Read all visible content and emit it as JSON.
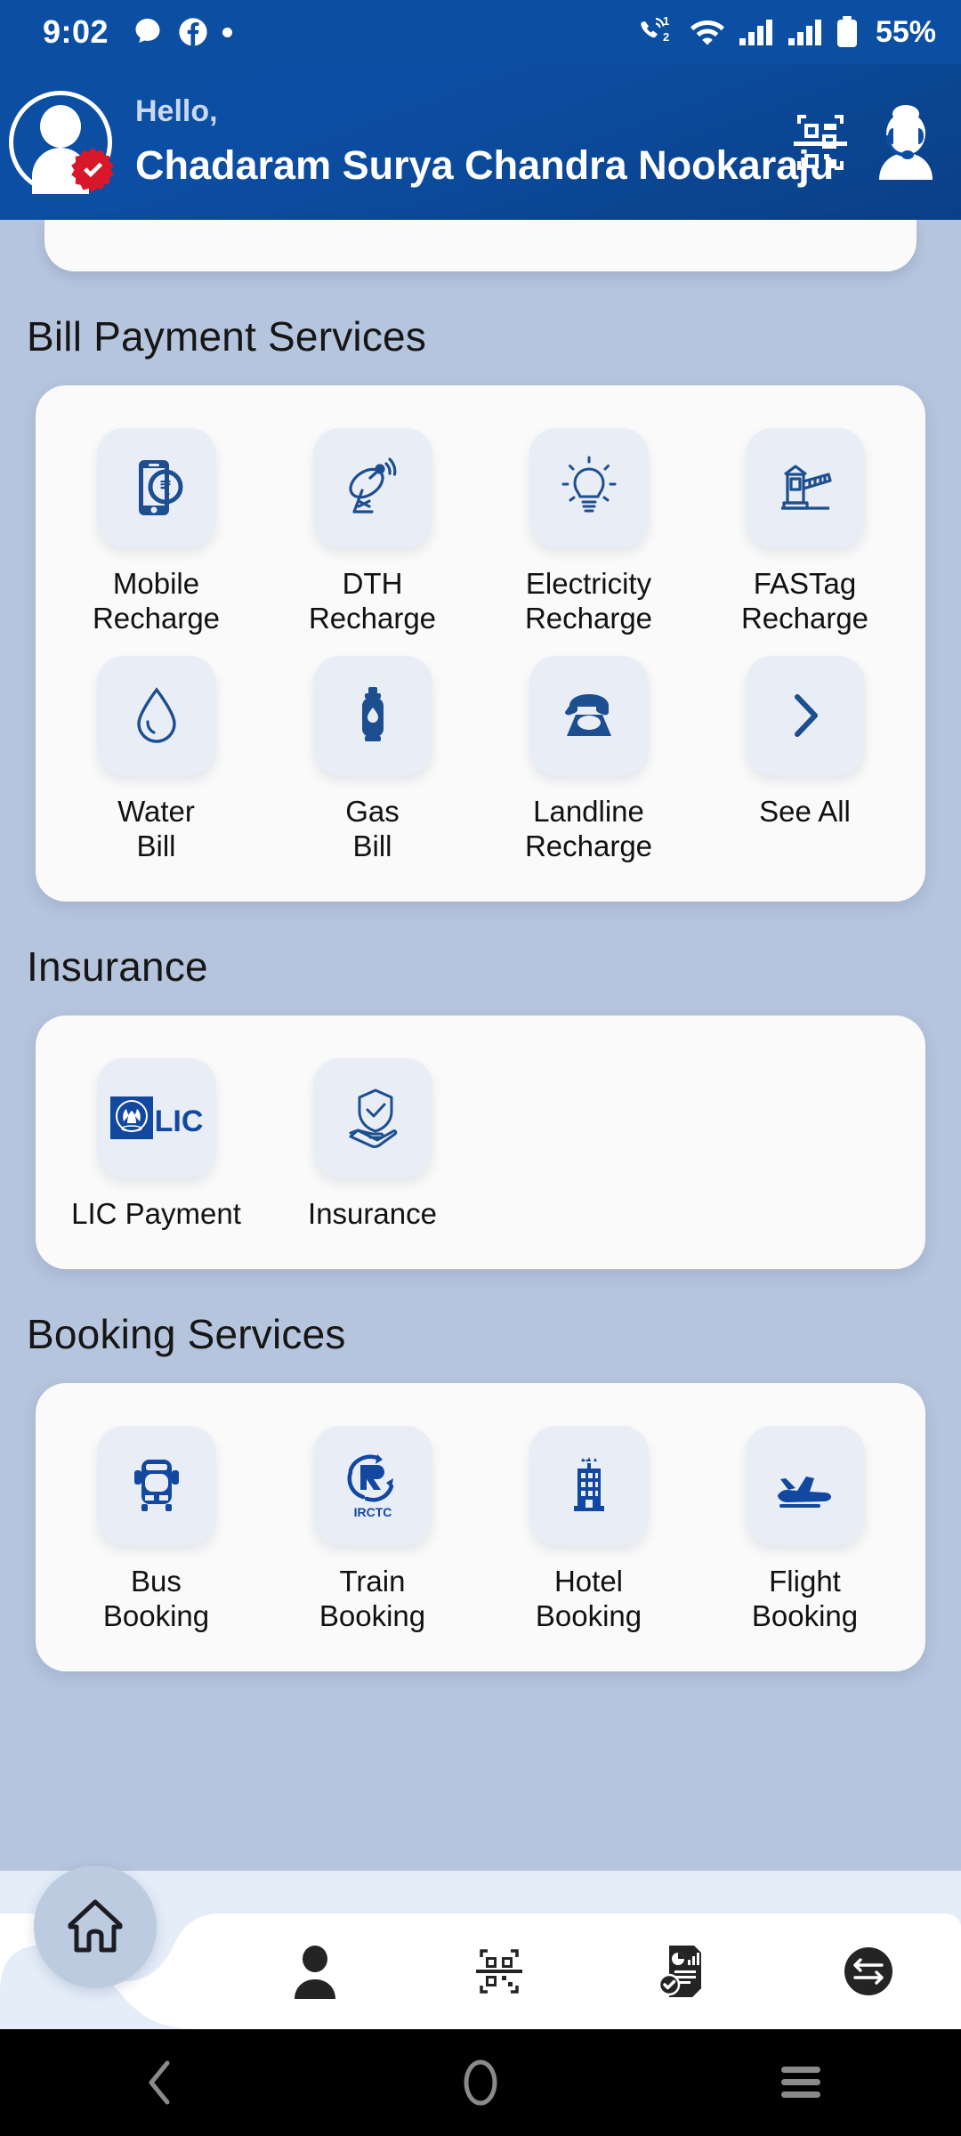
{
  "statusbar": {
    "time": "9:02",
    "icons": [
      "message-icon",
      "facebook-icon",
      "dot-indicator"
    ],
    "call_badge_top": "1",
    "call_badge_bottom": "2",
    "battery_percent": "55%",
    "right_icons": [
      "call-dual-sim-icon",
      "wifi-icon",
      "signal-sim1-icon",
      "signal-sim2-icon",
      "battery-icon"
    ]
  },
  "header": {
    "greeting": "Hello,",
    "name": "Chadaram Surya Chandra Nookaraju",
    "avatar_name": "avatar",
    "verified_badge": "verified-badge-icon",
    "scan_icon": "qr-scan-icon",
    "support_icon": "customer-support-icon",
    "bg_color": "#0b4ea2"
  },
  "sections": [
    {
      "title": "Bill Payment Services",
      "name": "bill-payment-services",
      "items": [
        {
          "label": "Mobile\nRecharge",
          "label_line1": "Mobile",
          "label_line2": "Recharge",
          "icon": "mobile-recharge-icon"
        },
        {
          "label": "DTH\nRecharge",
          "label_line1": "DTH",
          "label_line2": "Recharge",
          "icon": "dth-dish-icon"
        },
        {
          "label": "Electricity\nRecharge",
          "label_line1": "Electricity",
          "label_line2": "Recharge",
          "icon": "electricity-bulb-icon"
        },
        {
          "label": "FASTag\nRecharge",
          "label_line1": "FASTag",
          "label_line2": "Recharge",
          "icon": "fastag-toll-icon"
        },
        {
          "label": "Water\nBill",
          "label_line1": "Water",
          "label_line2": "Bill",
          "icon": "water-drop-icon"
        },
        {
          "label": "Gas\nBill",
          "label_line1": "Gas",
          "label_line2": "Bill",
          "icon": "gas-cylinder-icon"
        },
        {
          "label": "Landline\nRecharge",
          "label_line1": "Landline",
          "label_line2": "Recharge",
          "icon": "landline-telephone-icon"
        },
        {
          "label": "See All",
          "label_line1": "See All",
          "label_line2": "",
          "icon": "chevron-right-icon"
        }
      ]
    },
    {
      "title": "Insurance",
      "name": "insurance",
      "items": [
        {
          "label": "LIC Payment",
          "label_line1": "LIC Payment",
          "label_line2": "",
          "icon": "lic-logo-icon"
        },
        {
          "label": "Insurance",
          "label_line1": "Insurance",
          "label_line2": "",
          "icon": "insurance-shield-hand-icon"
        }
      ]
    },
    {
      "title": "Booking Services",
      "name": "booking-services",
      "items": [
        {
          "label": "Bus\nBooking",
          "label_line1": "Bus",
          "label_line2": "Booking",
          "icon": "bus-icon"
        },
        {
          "label": "Train\nBooking",
          "label_line1": "Train",
          "label_line2": "Booking",
          "icon": "irctc-train-icon"
        },
        {
          "label": "Hotel\nBooking",
          "label_line1": "Hotel",
          "label_line2": "Booking",
          "icon": "hotel-building-icon"
        },
        {
          "label": "Flight\nBooking",
          "label_line1": "Flight",
          "label_line2": "Booking",
          "icon": "flight-plane-icon"
        }
      ]
    }
  ],
  "lic": {
    "text": "LIC"
  },
  "irctc": {
    "text": "IRCTC"
  },
  "bottom_nav": {
    "items": [
      {
        "name": "nav-home",
        "icon": "home-icon",
        "active": true
      },
      {
        "name": "nav-profile",
        "icon": "person-icon",
        "active": false
      },
      {
        "name": "nav-scan",
        "icon": "qr-scan-icon",
        "active": false
      },
      {
        "name": "nav-reports",
        "icon": "report-document-icon",
        "active": false
      },
      {
        "name": "nav-transfer",
        "icon": "transfer-arrows-icon",
        "active": false
      }
    ]
  },
  "android_nav": {
    "back": "back-icon",
    "home": "home-circle-icon",
    "recents": "recents-icon"
  },
  "colors": {
    "brand_blue": "#0b4ea2",
    "icon_blue": "#1d4e8f",
    "page_bg": "#b6c5de",
    "card_bg": "#fafafa",
    "tile_bg": "#e9edf6"
  }
}
